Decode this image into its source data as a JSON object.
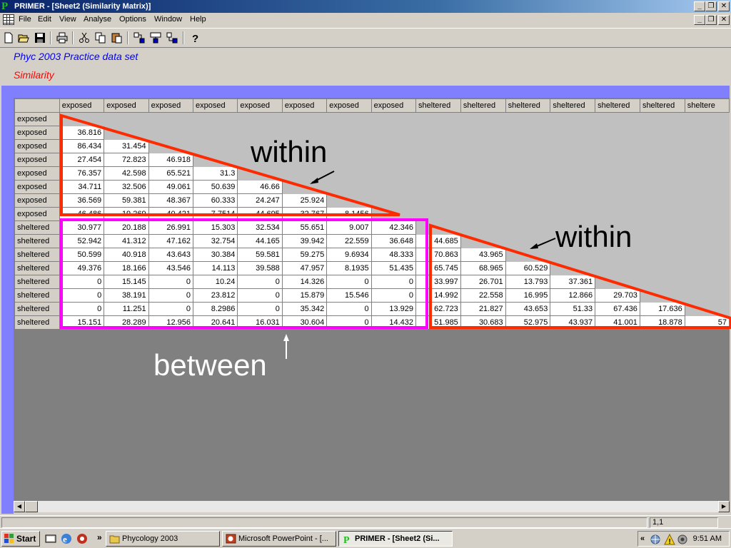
{
  "window": {
    "title": "PRIMER - [Sheet2 (Similarity Matrix)]",
    "app_icon_letter": "P"
  },
  "menu": [
    "File",
    "Edit",
    "View",
    "Analyse",
    "Options",
    "Window",
    "Help"
  ],
  "toolbar": {
    "icons": [
      "new-icon",
      "open-icon",
      "save-icon",
      "print-icon",
      "cut-icon",
      "copy-icon",
      "paste-icon",
      "tool-a-icon",
      "tool-b-icon",
      "tool-c-icon",
      "help-icon"
    ]
  },
  "sheet": {
    "title": "Phyc 2003 Practice data set",
    "subtitle": "Similarity",
    "col_headers": [
      "exposed",
      "exposed",
      "exposed",
      "exposed",
      "exposed",
      "exposed",
      "exposed",
      "exposed",
      "sheltered",
      "sheltered",
      "sheltered",
      "sheltered",
      "sheltered",
      "sheltered",
      "sheltere"
    ],
    "rows": [
      {
        "label": "exposed",
        "values": []
      },
      {
        "label": "exposed",
        "values": [
          "36.816"
        ]
      },
      {
        "label": "exposed",
        "values": [
          "86.434",
          "31.454"
        ]
      },
      {
        "label": "exposed",
        "values": [
          "27.454",
          "72.823",
          "46.918"
        ]
      },
      {
        "label": "exposed",
        "values": [
          "76.357",
          "42.598",
          "65.521",
          "31.3"
        ]
      },
      {
        "label": "exposed",
        "values": [
          "34.711",
          "32.506",
          "49.061",
          "50.639",
          "46.66"
        ]
      },
      {
        "label": "exposed",
        "values": [
          "36.569",
          "59.381",
          "48.367",
          "60.333",
          "24.247",
          "25.924"
        ]
      },
      {
        "label": "exposed",
        "values": [
          "46.486",
          "19.269",
          "40.421",
          "7.7514",
          "44.695",
          "32.767",
          "8.1456"
        ]
      },
      {
        "label": "sheltered",
        "values": [
          "30.977",
          "20.188",
          "26.991",
          "15.303",
          "32.534",
          "55.651",
          "9.007",
          "42.346"
        ]
      },
      {
        "label": "sheltered",
        "values": [
          "52.942",
          "41.312",
          "47.162",
          "32.754",
          "44.165",
          "39.942",
          "22.559",
          "36.648",
          "44.685"
        ]
      },
      {
        "label": "sheltered",
        "values": [
          "50.599",
          "40.918",
          "43.643",
          "30.384",
          "59.581",
          "59.275",
          "9.6934",
          "48.333",
          "70.863",
          "43.965"
        ]
      },
      {
        "label": "sheltered",
        "values": [
          "49.376",
          "18.166",
          "43.546",
          "14.113",
          "39.588",
          "47.957",
          "8.1935",
          "51.435",
          "65.745",
          "68.965",
          "60.529"
        ]
      },
      {
        "label": "sheltered",
        "values": [
          "0",
          "15.145",
          "0",
          "10.24",
          "0",
          "14.326",
          "0",
          "0",
          "33.997",
          "26.701",
          "13.793",
          "37.361"
        ]
      },
      {
        "label": "sheltered",
        "values": [
          "0",
          "38.191",
          "0",
          "23.812",
          "0",
          "15.879",
          "15.546",
          "0",
          "14.992",
          "22.558",
          "16.995",
          "12.866",
          "29.703"
        ]
      },
      {
        "label": "sheltered",
        "values": [
          "0",
          "11.251",
          "0",
          "8.2986",
          "0",
          "35.342",
          "0",
          "13.929",
          "62.723",
          "21.827",
          "43.653",
          "51.33",
          "67.436",
          "17.636"
        ]
      },
      {
        "label": "sheltered",
        "values": [
          "15.151",
          "28.289",
          "12.956",
          "20.641",
          "16.031",
          "30.604",
          "0",
          "14.432",
          "51.985",
          "30.683",
          "52.975",
          "43.937",
          "41.001",
          "18.878",
          "57"
        ]
      }
    ]
  },
  "annotations": {
    "within_1": "within",
    "within_2": "within",
    "between": "between",
    "triangle_color": "#ff2a00",
    "box_color": "#ff00ff"
  },
  "status": {
    "cell_ref": "1,1"
  },
  "taskbar": {
    "start_label": "Start",
    "tasks": [
      {
        "label": "Phycology 2003",
        "icon": "folder-icon"
      },
      {
        "label": "Microsoft PowerPoint - [...",
        "icon": "powerpoint-icon"
      },
      {
        "label": "PRIMER - [Sheet2 (Si...",
        "icon": "primer-icon"
      }
    ],
    "chevron": "»",
    "tray_chevron": "«",
    "clock": "9:51 AM"
  }
}
